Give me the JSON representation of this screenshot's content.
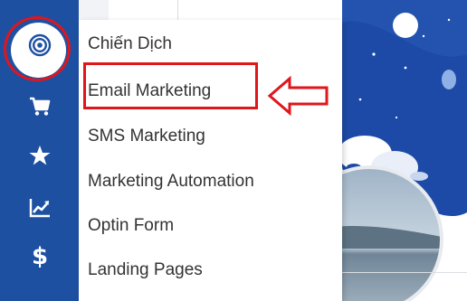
{
  "menu": {
    "items": [
      {
        "label": "Chiến Dịch"
      },
      {
        "label": "Email Marketing"
      },
      {
        "label": "SMS Marketing"
      },
      {
        "label": "Marketing Automation"
      },
      {
        "label": "Optin Form"
      },
      {
        "label": "Landing Pages"
      }
    ]
  },
  "sidebar": {
    "icons": [
      "target-icon",
      "cart-icon",
      "star-icon",
      "chart-line-icon",
      "dollar-icon"
    ]
  },
  "colors": {
    "sidebar": "#1e50a2",
    "annotation": "#e0161b",
    "art_blue": "#1d4aa6"
  }
}
